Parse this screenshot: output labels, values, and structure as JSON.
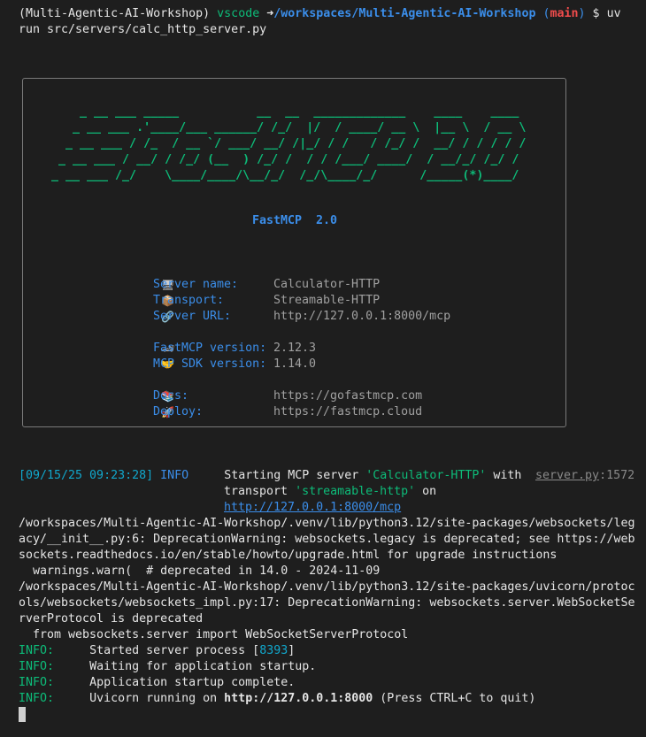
{
  "prompt": {
    "venv": "(Multi-Agentic-AI-Workshop)",
    "user": "vscode",
    "arrow": "➜",
    "path": "/workspaces/Multi-Agentic-AI-Workshop",
    "branch_open": "(",
    "branch": "main",
    "branch_close": ")",
    "dollar": "$",
    "command_part1": "uv",
    "command_part2": "run src/servers/calc_http_server.py"
  },
  "banner": {
    "ascii_lines": [
      "    _ __ ___ _____           __  __  _____________    ____    ____ ",
      "   _ __ ___ .'____/___ ______/ /_/  |/  / ____/ __ \\  |__ \\  / __ \\",
      "  _ __ ___ / /_  / __ `/ ___/ __/ /|_/ / /   / /_/ /  __/ / / / / /",
      " _ __ ___ / __/ / /_/ (__  ) /_/ /  / / /___/ ____/  / __/_/ /_/ / ",
      "_ __ ___ /_/    \\____/____/\\__/_/  /_/\\____/_/      /_____(*)____/  "
    ],
    "title": "FastMCP  2.0",
    "rows": [
      {
        "icon": "🖥",
        "icon_name": "monitor-icon",
        "label": "Server name:",
        "value": "Calculator-HTTP"
      },
      {
        "icon": "📦",
        "icon_name": "package-icon",
        "label": "Transport:",
        "value": "Streamable-HTTP"
      },
      {
        "icon": "🔗",
        "icon_name": "link-icon",
        "label": "Server URL:",
        "value": "http://127.0.0.1:8000/mcp"
      },
      {
        "icon": "🏎",
        "icon_name": "race-car-icon",
        "label": "FastMCP version:",
        "value": "2.12.3"
      },
      {
        "icon": "🤝",
        "icon_name": "handshake-icon",
        "label": "MCP SDK version:",
        "value": "1.14.0"
      },
      {
        "icon": "📚",
        "icon_name": "books-icon",
        "label": "Docs:",
        "value": "https://gofastmcp.com"
      },
      {
        "icon": "🚀",
        "icon_name": "rocket-icon",
        "label": "Deploy:",
        "value": "https://fastmcp.cloud"
      }
    ]
  },
  "log": {
    "timestamp": "[09/15/25 09:23:28]",
    "level": "INFO",
    "msg_part1": "Starting MCP server ",
    "server_quoted": "'Calculator-HTTP'",
    "msg_part2": " with",
    "msg_line2_a": "transport ",
    "transport_quoted": "'streamable-http'",
    "msg_line2_b": " on",
    "url": "http://127.0.0.1:8000/mcp",
    "source_file": "server.py",
    "source_line": ":1572"
  },
  "warnings": [
    "/workspaces/Multi-Agentic-AI-Workshop/.venv/lib/python3.12/site-packages/websockets/leg",
    "acy/__init__.py:6: DeprecationWarning: websockets.legacy is deprecated; see https://web",
    "sockets.readthedocs.io/en/stable/howto/upgrade.html for upgrade instructions",
    "  warnings.warn(  # deprecated in 14.0 - 2024-11-09",
    "/workspaces/Multi-Agentic-AI-Workshop/.venv/lib/python3.12/site-packages/uvicorn/protoc",
    "ols/websockets/websockets_impl.py:17: DeprecationWarning: websockets.server.WebSocketSe",
    "rverProtocol is deprecated",
    "  from websockets.server import WebSocketServerProtocol"
  ],
  "uvicorn": {
    "level": "INFO:",
    "line1_a": "Started server process [",
    "pid": "8393",
    "line1_b": "]",
    "line2": "Waiting for application startup.",
    "line3": "Application startup complete.",
    "line4_a": "Uvicorn running on ",
    "line4_url": "http://127.0.0.1:8000",
    "line4_b": " (Press CTRL+C to quit)"
  },
  "colors": {
    "background": "#1e1e1e",
    "green": "#0dbc79",
    "blue": "#3b8eea",
    "red": "#f14c4c",
    "cyan": "#11a8cd"
  }
}
